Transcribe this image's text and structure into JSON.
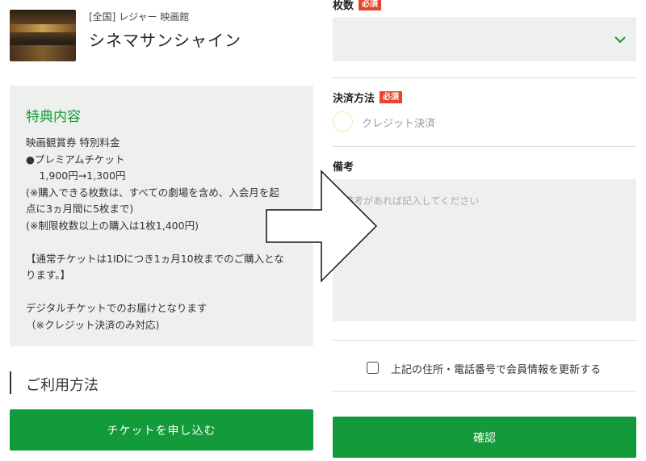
{
  "shop": {
    "category": "[全国] レジャー 映画館",
    "name": "シネマサンシャイン"
  },
  "benefit": {
    "heading": "特典内容",
    "lines": [
      "映画観賞券 特別料金",
      "●プレミアムチケット",
      "　 1,900円→1,300円",
      "(※購入できる枚数は、すべての劇場を含め、入会月を起",
      "点に3ヵ月間に5枚まで)",
      "(※制限枚数以上の購入は1枚1,400円)",
      "",
      "【通常チケットは1IDにつき1ヵ月10枚までのご購入とな",
      "ります。】",
      "",
      "デジタルチケットでのお届けとなります",
      "（※クレジット決済のみ対応)"
    ]
  },
  "usage": {
    "heading": "ご利用方法"
  },
  "apply_button": "チケットを申し込む",
  "form": {
    "quantity_label": "枚数",
    "required_badge": "必須",
    "quantity_value": "",
    "payment_label": "決済方法",
    "payment_option": "クレジット決済",
    "memo_label": "備考",
    "memo_placeholder": "備考があれば記入してください",
    "update_info_label": "上記の住所・電話番号で会員情報を更新する",
    "confirm_button": "確認"
  },
  "colors": {
    "accent": "#139a3a",
    "required": "#e8452c",
    "field_bg": "#eef0ee"
  },
  "icons": {
    "select_chevron": "chevron-down-icon",
    "overlay_arrow": "right-arrow-icon"
  }
}
